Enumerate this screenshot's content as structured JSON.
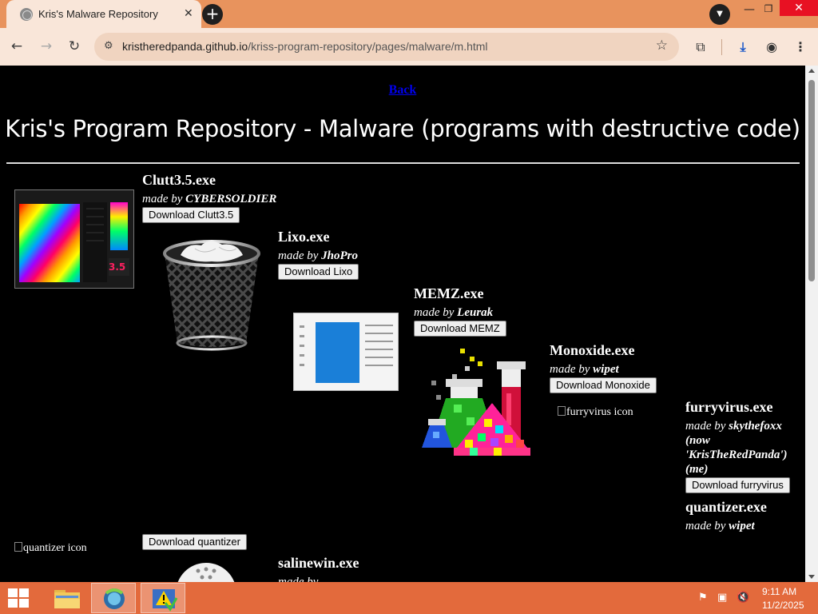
{
  "browser": {
    "tab_title": "Kris's Malware Repository",
    "tab_close": "✕",
    "new_tab": "+",
    "url_host": "kristheredpanda.github.io",
    "url_path": "/kriss-program-repository/pages/malware/m.html"
  },
  "page": {
    "back_link": "Back",
    "title": "Kris's Program Repository - Malware (programs with destructive code)",
    "programs": [
      {
        "name": "Clutt3.5.exe",
        "made_by": "made by",
        "author": "CYBERSOLDIER",
        "button": "Download Clutt3.5",
        "image_label": "3.5"
      },
      {
        "name": "Lixo.exe",
        "made_by": "made by",
        "author": "JhoPro",
        "button": "Download Lixo"
      },
      {
        "name": "MEMZ.exe",
        "made_by": "made by",
        "author": "Leurak",
        "button": "Download MEMZ"
      },
      {
        "name": "Monoxide.exe",
        "made_by": "made by",
        "author": "wipet",
        "button": "Download Monoxide"
      },
      {
        "name": "furryvirus.exe",
        "made_by": "made by",
        "author": "skythefoxx",
        "author_note": "(now 'KrisTheRedPanda') (me)",
        "button": "Download furryvirus",
        "broken_icon_alt": "furryvirus icon"
      },
      {
        "name": "quantizer.exe",
        "made_by": "made by",
        "author": "wipet",
        "button": "Download quantizer",
        "broken_icon_alt": "quantizer icon"
      },
      {
        "name": "salinewin.exe",
        "made_by": "made by",
        "author": ""
      }
    ]
  },
  "taskbar": {
    "time": "9:11 AM",
    "date": "11/2/2025"
  },
  "colors": {
    "tabbar": "#e8935d",
    "toolbar": "#f9e6d9",
    "taskbar": "#e36a3c",
    "page_bg": "#000000",
    "link": "#0000ee"
  }
}
